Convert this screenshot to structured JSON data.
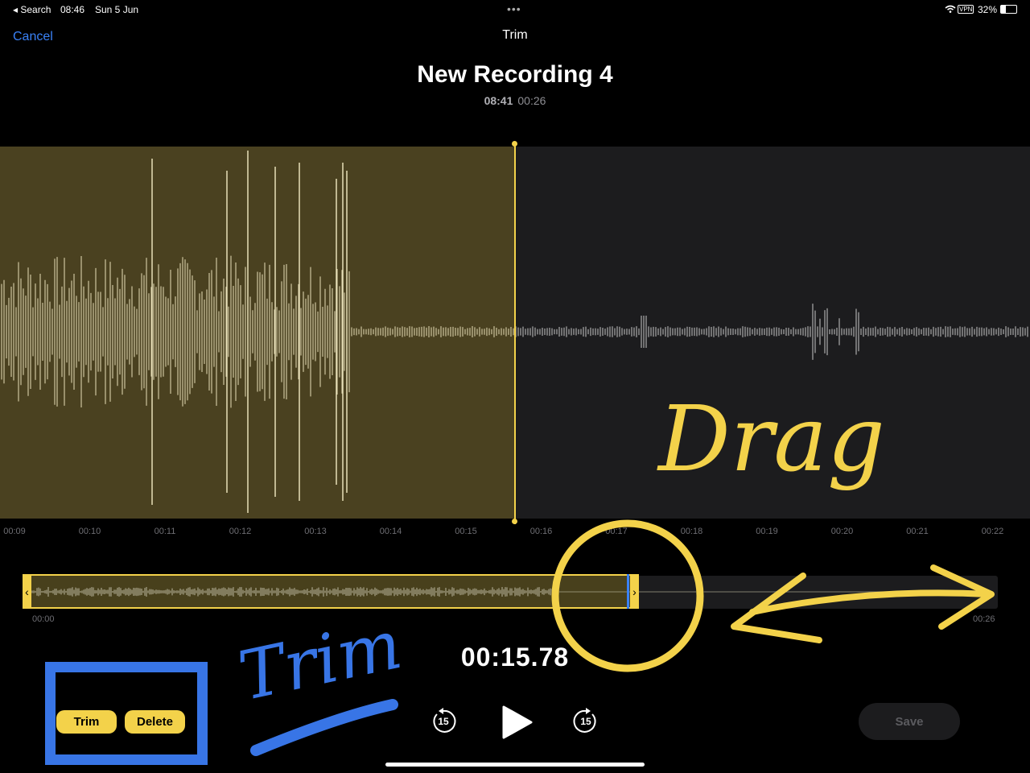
{
  "status_bar": {
    "back": "◂ Search",
    "time": "08:46",
    "date": "Sun 5 Jun",
    "vpn": "VPN",
    "battery": "32%"
  },
  "nav": {
    "cancel_label": "Cancel",
    "title": "Trim"
  },
  "recording": {
    "title": "New Recording 4",
    "created": "08:41",
    "duration": "00:26"
  },
  "main_ruler": [
    "00:09",
    "00:10",
    "00:11",
    "00:12",
    "00:13",
    "00:14",
    "00:15",
    "00:16",
    "00:17",
    "00:18",
    "00:19",
    "00:20",
    "00:21",
    "00:22"
  ],
  "overview": {
    "start_label": "00:00",
    "end_label": "00:26",
    "left_handle": "‹",
    "right_handle": "›"
  },
  "playback": {
    "current_time": "00:15.78",
    "skip_back": "15",
    "skip_forward": "15"
  },
  "actions": {
    "trim_label": "Trim",
    "delete_label": "Delete",
    "save_label": "Save"
  },
  "annotations": {
    "drag_text": "Drag",
    "trim_text": "Trim"
  },
  "colors": {
    "accent_yellow": "#f3d24a",
    "link_blue": "#3a82f7",
    "annotation_blue": "#3875e6"
  }
}
